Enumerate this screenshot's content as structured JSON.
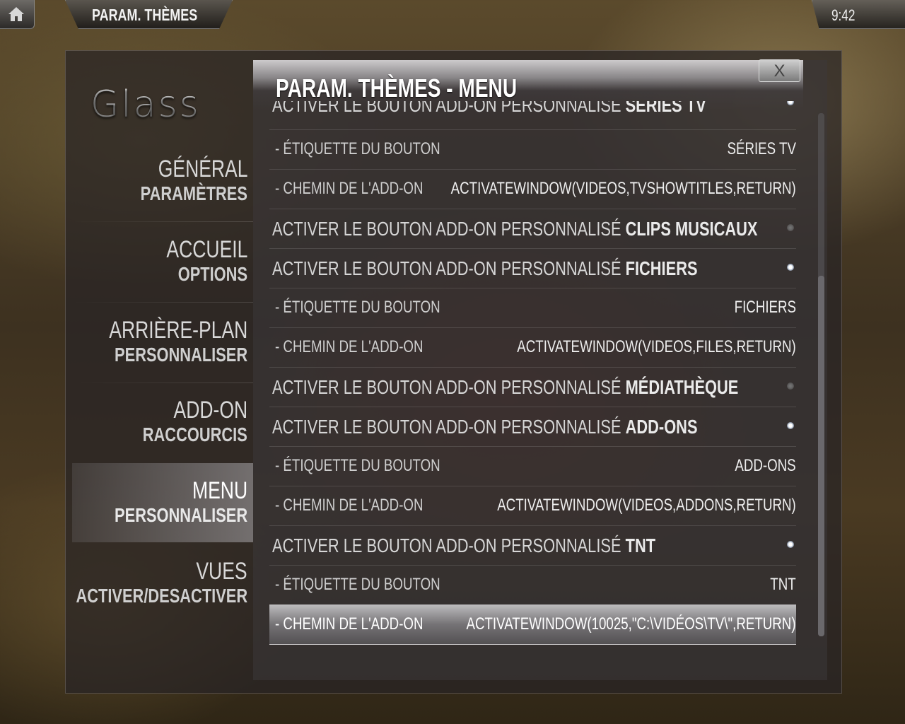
{
  "topbar": {
    "title": "PARAM. THÈMES",
    "clock": "9:42"
  },
  "logo": "Glass",
  "nav": [
    {
      "line1": "GÉNÉRAL",
      "line2": "PARAMÈTRES"
    },
    {
      "line1": "ACCUEIL",
      "line2": "OPTIONS"
    },
    {
      "line1": "ARRIÈRE-PLAN",
      "line2": "PERSONNALISER"
    },
    {
      "line1": "ADD-ON",
      "line2": "RACCOURCIS"
    },
    {
      "line1": "MENU",
      "line2": "PERSONNALISER",
      "active": true
    },
    {
      "line1": "VUES",
      "line2": "ACTIVER/DESACTIVER"
    }
  ],
  "content": {
    "title": "PARAM. THÈMES - MENU",
    "close_label": "X",
    "rows": [
      {
        "prefix": "ACTIVER LE BOUTON ADD-ON PERSONNALISÉ ",
        "bold": "SÉRIES TV",
        "radio": "on"
      },
      {
        "label": "- ÉTIQUETTE DU BOUTON",
        "value": "SÉRIES TV"
      },
      {
        "label": "- CHEMIN DE L'ADD-ON",
        "value": "ACTIVATEWINDOW(VIDEOS,TVSHOWTITLES,RETURN)"
      },
      {
        "prefix": "ACTIVER LE BOUTON ADD-ON PERSONNALISÉ ",
        "bold": "CLIPS MUSICAUX",
        "radio": "off"
      },
      {
        "prefix": "ACTIVER LE BOUTON ADD-ON PERSONNALISÉ ",
        "bold": "FICHIERS",
        "radio": "on"
      },
      {
        "label": "- ÉTIQUETTE DU BOUTON",
        "value": "FICHIERS"
      },
      {
        "label": "- CHEMIN DE L'ADD-ON",
        "value": "ACTIVATEWINDOW(VIDEOS,FILES,RETURN)"
      },
      {
        "prefix": "ACTIVER LE BOUTON ADD-ON PERSONNALISÉ ",
        "bold": "MÉDIATHÈQUE",
        "radio": "off"
      },
      {
        "prefix": "ACTIVER LE BOUTON ADD-ON PERSONNALISÉ ",
        "bold": "ADD-ONS",
        "radio": "on"
      },
      {
        "label": "- ÉTIQUETTE DU BOUTON",
        "value": "ADD-ONS"
      },
      {
        "label": "- CHEMIN DE L'ADD-ON",
        "value": "ACTIVATEWINDOW(VIDEOS,ADDONS,RETURN)"
      },
      {
        "prefix": "ACTIVER LE BOUTON ADD-ON PERSONNALISÉ ",
        "bold": "TNT",
        "radio": "on"
      },
      {
        "label": "- ÉTIQUETTE DU BOUTON",
        "value": "TNT"
      },
      {
        "label": "- CHEMIN DE L'ADD-ON",
        "value": "ACTIVATEWINDOW(10025,\"C:\\VIDÉOS\\TV\\\",RETURN)",
        "selected": true
      }
    ]
  },
  "icons": {
    "home": "home-icon",
    "close": "close-icon"
  }
}
